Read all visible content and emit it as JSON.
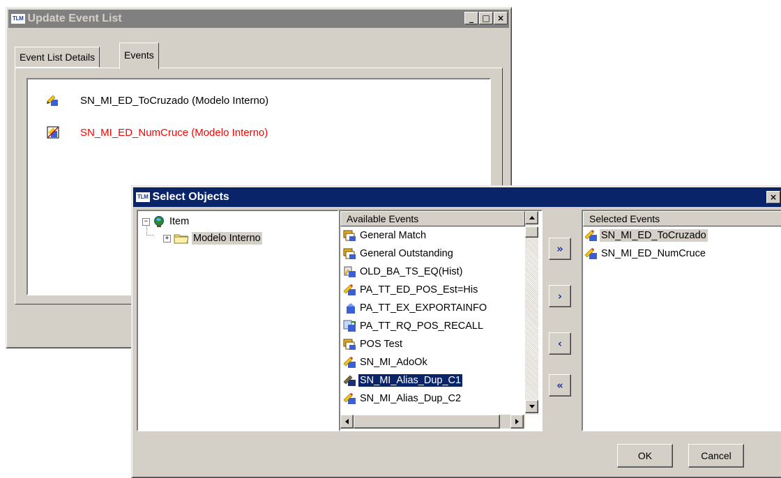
{
  "update_window": {
    "title": "Update Event List",
    "logo": "TLM",
    "caption_buttons": {
      "minimize": "_",
      "maximize": "□",
      "close": "×"
    },
    "tabs": [
      {
        "label": "Event List Details",
        "active": false
      },
      {
        "label": "Events",
        "active": true
      }
    ],
    "events": [
      {
        "label": "SN_MI_ED_ToCruzado (Modelo Interno)",
        "color": "#000000",
        "icon": "event-pencil-icon"
      },
      {
        "label": "SN_MI_ED_NumCruce (Modelo Interno)",
        "color": "#ff0000",
        "icon": "event-checked-icon"
      }
    ]
  },
  "select_dialog": {
    "title": "Select Objects",
    "logo": "TLM",
    "close": "×",
    "tree": {
      "root": {
        "label": "Item",
        "expander": "−",
        "icon": "globe-icon"
      },
      "child": {
        "label": "Modelo Interno",
        "expander": "+",
        "icon": "folder-icon"
      }
    },
    "available": {
      "header": "Available Events",
      "items": [
        {
          "label": "General Match",
          "icon": "group-match-icon",
          "selected": false
        },
        {
          "label": "General Outstanding",
          "icon": "group-match-icon",
          "selected": false
        },
        {
          "label": "OLD_BA_TS_EQ(Hist)",
          "icon": "history-event-icon",
          "selected": false
        },
        {
          "label": "PA_TT_ED_POS_Est=His",
          "icon": "event-pencil-icon",
          "selected": false
        },
        {
          "label": "PA_TT_EX_EXPORTAINFO",
          "icon": "event-icon",
          "selected": false
        },
        {
          "label": "PA_TT_RQ_POS_RECALL",
          "icon": "request-icon",
          "selected": false
        },
        {
          "label": "POS Test",
          "icon": "group-match-icon",
          "selected": false
        },
        {
          "label": "SN_MI_AdoOk",
          "icon": "event-pencil-icon",
          "selected": false
        },
        {
          "label": "SN_MI_Alias_Dup_C1",
          "icon": "event-pencil-icon",
          "selected": true
        },
        {
          "label": "SN_MI_Alias_Dup_C2",
          "icon": "event-pencil-icon",
          "selected": false
        }
      ]
    },
    "transfer_buttons": {
      "add_all": "»",
      "add": "›",
      "remove": "‹",
      "remove_all": "«"
    },
    "selected": {
      "header": "Selected Events",
      "items": [
        {
          "label": "SN_MI_ED_ToCruzado",
          "selected": true
        },
        {
          "label": "SN_MI_ED_NumCruce",
          "selected": false
        }
      ]
    },
    "buttons": {
      "ok": "OK",
      "cancel": "Cancel"
    }
  }
}
